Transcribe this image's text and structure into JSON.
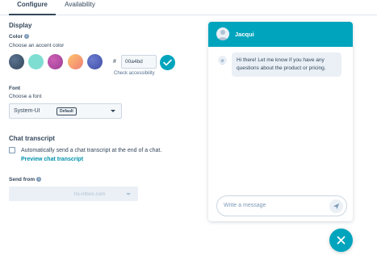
{
  "tabs": [
    {
      "label": "Configure",
      "active": true
    },
    {
      "label": "Availability",
      "active": false
    }
  ],
  "display": {
    "heading": "Display",
    "color_label": "Color",
    "color_hint": "Choose an accent color",
    "swatches": [
      {
        "name": "dark-blue",
        "color": "#425b76"
      },
      {
        "name": "light-teal",
        "color": "#7fded2"
      },
      {
        "name": "magenta",
        "color": "#b54ca8"
      },
      {
        "name": "orange-gradient",
        "color": "#f7a46c"
      },
      {
        "name": "indigo",
        "color": "#4e5fb4"
      }
    ],
    "hash": "#",
    "hex_value": "00a4bd",
    "accent": "#00a4bd",
    "check_accessibility": "Check accessibility"
  },
  "font": {
    "label": "Font",
    "hint": "Choose a font",
    "selected": "System-UI",
    "badge": "Default"
  },
  "transcript": {
    "heading": "Chat transcript",
    "checkbox_label": "Automatically send a chat transcript at the end of a chat.",
    "checked": false,
    "link": "Preview chat transcript"
  },
  "send_from": {
    "label": "Send from",
    "value": "hs-inbox.com"
  },
  "chat_preview": {
    "agent_name": "Jacqui",
    "message": "Hi there! Let me know if you have any questions about the product or pricing.",
    "compose_placeholder": "Write a message",
    "header_color": "#00a4bd"
  }
}
